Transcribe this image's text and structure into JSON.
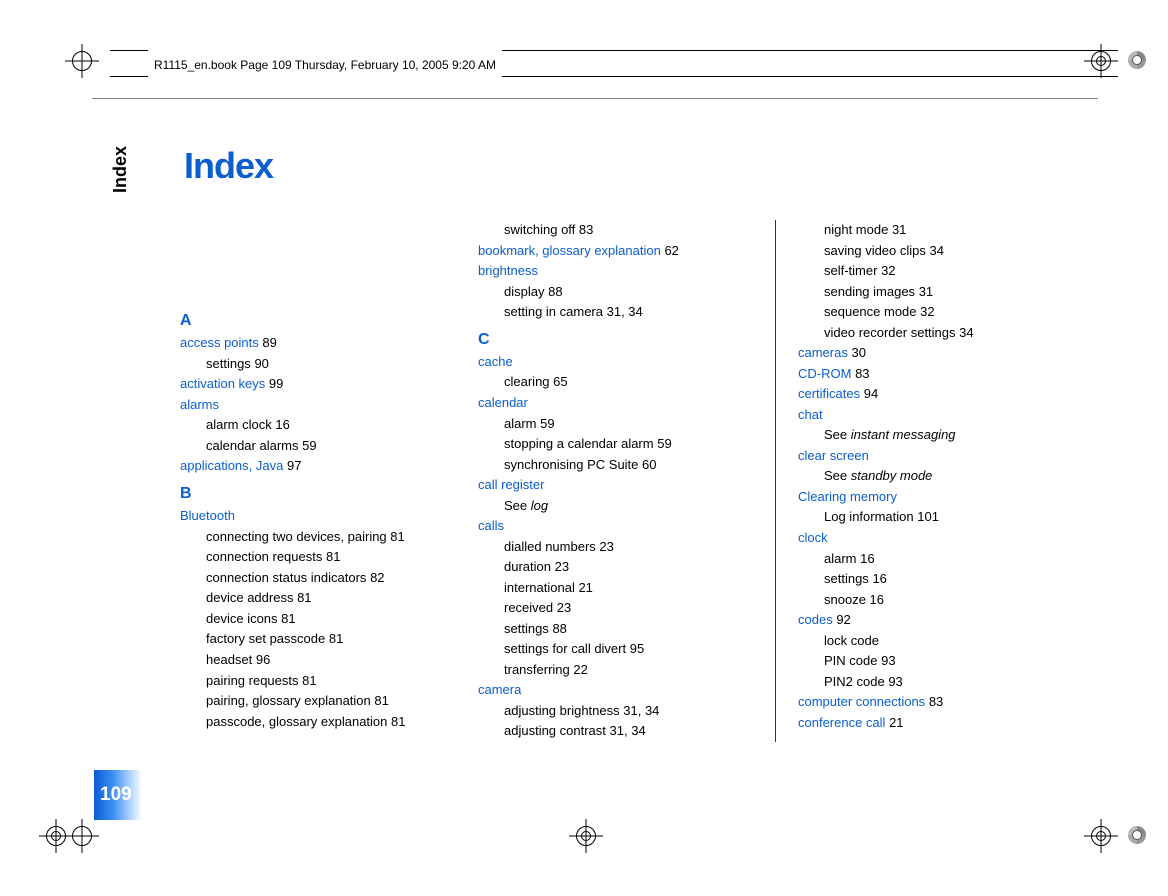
{
  "header": {
    "imprint": "R1115_en.book  Page 109  Thursday, February 10, 2005  9:20 AM"
  },
  "sidebar": {
    "label": "Index"
  },
  "page_number": "109",
  "title": "Index",
  "col1": {
    "A": {
      "letter": "A",
      "access_points": {
        "term": "access points",
        "page": "89",
        "subs": [
          {
            "label": "settings",
            "page": "90"
          }
        ]
      },
      "activation_keys": {
        "term": "activation keys",
        "page": "99"
      },
      "alarms": {
        "term": "alarms",
        "subs": [
          {
            "label": "alarm clock",
            "page": "16"
          },
          {
            "label": "calendar alarms",
            "page": "59"
          }
        ]
      },
      "applications_java": {
        "term": "applications, Java",
        "page": "97"
      }
    },
    "B": {
      "letter": "B",
      "bluetooth": {
        "term": "Bluetooth",
        "subs": [
          {
            "label": "connecting two devices, pairing",
            "page": "81"
          },
          {
            "label": "connection requests",
            "page": "81"
          },
          {
            "label": "connection status indicators",
            "page": "82"
          },
          {
            "label": "device address",
            "page": "81"
          },
          {
            "label": "device icons",
            "page": "81"
          },
          {
            "label": "factory set passcode",
            "page": "81"
          },
          {
            "label": "headset",
            "page": "96"
          },
          {
            "label": "pairing requests",
            "page": "81"
          },
          {
            "label": "pairing, glossary explanation",
            "page": "81"
          },
          {
            "label": "passcode, glossary explanation",
            "page": "81"
          }
        ]
      }
    }
  },
  "col2": {
    "top": {
      "switching_off": {
        "label": "switching off",
        "page": "83"
      }
    },
    "bookmark": {
      "term": "bookmark, glossary explanation",
      "page": "62"
    },
    "brightness": {
      "term": "brightness",
      "subs": [
        {
          "label": "display",
          "page": "88"
        },
        {
          "label": "setting in camera",
          "pages": "31, 34"
        }
      ]
    },
    "C": {
      "letter": "C",
      "cache": {
        "term": "cache",
        "subs": [
          {
            "label": "clearing",
            "page": "65"
          }
        ]
      },
      "calendar": {
        "term": "calendar",
        "subs": [
          {
            "label": "alarm",
            "page": "59"
          },
          {
            "label": "stopping a calendar alarm",
            "page": "59"
          },
          {
            "label": "synchronising PC Suite",
            "page": "60"
          }
        ]
      },
      "call_register": {
        "term": "call register",
        "see": "See log"
      },
      "calls": {
        "term": "calls",
        "subs": [
          {
            "label": "dialled numbers",
            "page": "23"
          },
          {
            "label": "duration",
            "page": "23"
          },
          {
            "label": "international",
            "page": "21"
          },
          {
            "label": "received",
            "page": "23"
          },
          {
            "label": "settings",
            "page": "88"
          },
          {
            "label": "settings for call divert",
            "page": "95"
          },
          {
            "label": "transferring",
            "page": "22"
          }
        ]
      },
      "camera": {
        "term": "camera",
        "subs": [
          {
            "label": "adjusting brightness",
            "pages": "31, 34"
          },
          {
            "label": "adjusting contrast",
            "pages": "31, 34"
          }
        ]
      }
    }
  },
  "col3": {
    "top": {
      "subs": [
        {
          "label": "night mode",
          "page": "31"
        },
        {
          "label": "saving video clips",
          "page": "34"
        },
        {
          "label": "self-timer",
          "page": "32"
        },
        {
          "label": "sending images",
          "page": "31"
        },
        {
          "label": "sequence mode",
          "page": "32"
        },
        {
          "label": "video recorder settings",
          "page": "34"
        }
      ]
    },
    "cameras": {
      "term": "cameras",
      "page": "30"
    },
    "cdrom": {
      "term": "CD-ROM",
      "page": "83"
    },
    "certificates": {
      "term": "certificates",
      "page": "94"
    },
    "chat": {
      "term": "chat",
      "see": "See instant messaging"
    },
    "clear_screen": {
      "term": "clear screen",
      "see": "See standby mode"
    },
    "clearing_memory": {
      "term": "Clearing memory",
      "subs": [
        {
          "label": "Log information",
          "page": "101"
        }
      ]
    },
    "clock": {
      "term": "clock",
      "subs": [
        {
          "label": "alarm",
          "page": "16"
        },
        {
          "label": "settings",
          "page": "16"
        },
        {
          "label": "snooze",
          "page": "16"
        }
      ]
    },
    "codes": {
      "term": "codes",
      "page": "92",
      "subs": [
        {
          "label": "lock code",
          "page": ""
        },
        {
          "label": "PIN code",
          "page": "93"
        },
        {
          "label": "PIN2 code",
          "page": "93"
        }
      ]
    },
    "computer_connections": {
      "term": "computer connections",
      "page": "83"
    },
    "conference_call": {
      "term": "conference call",
      "page": "21"
    }
  }
}
